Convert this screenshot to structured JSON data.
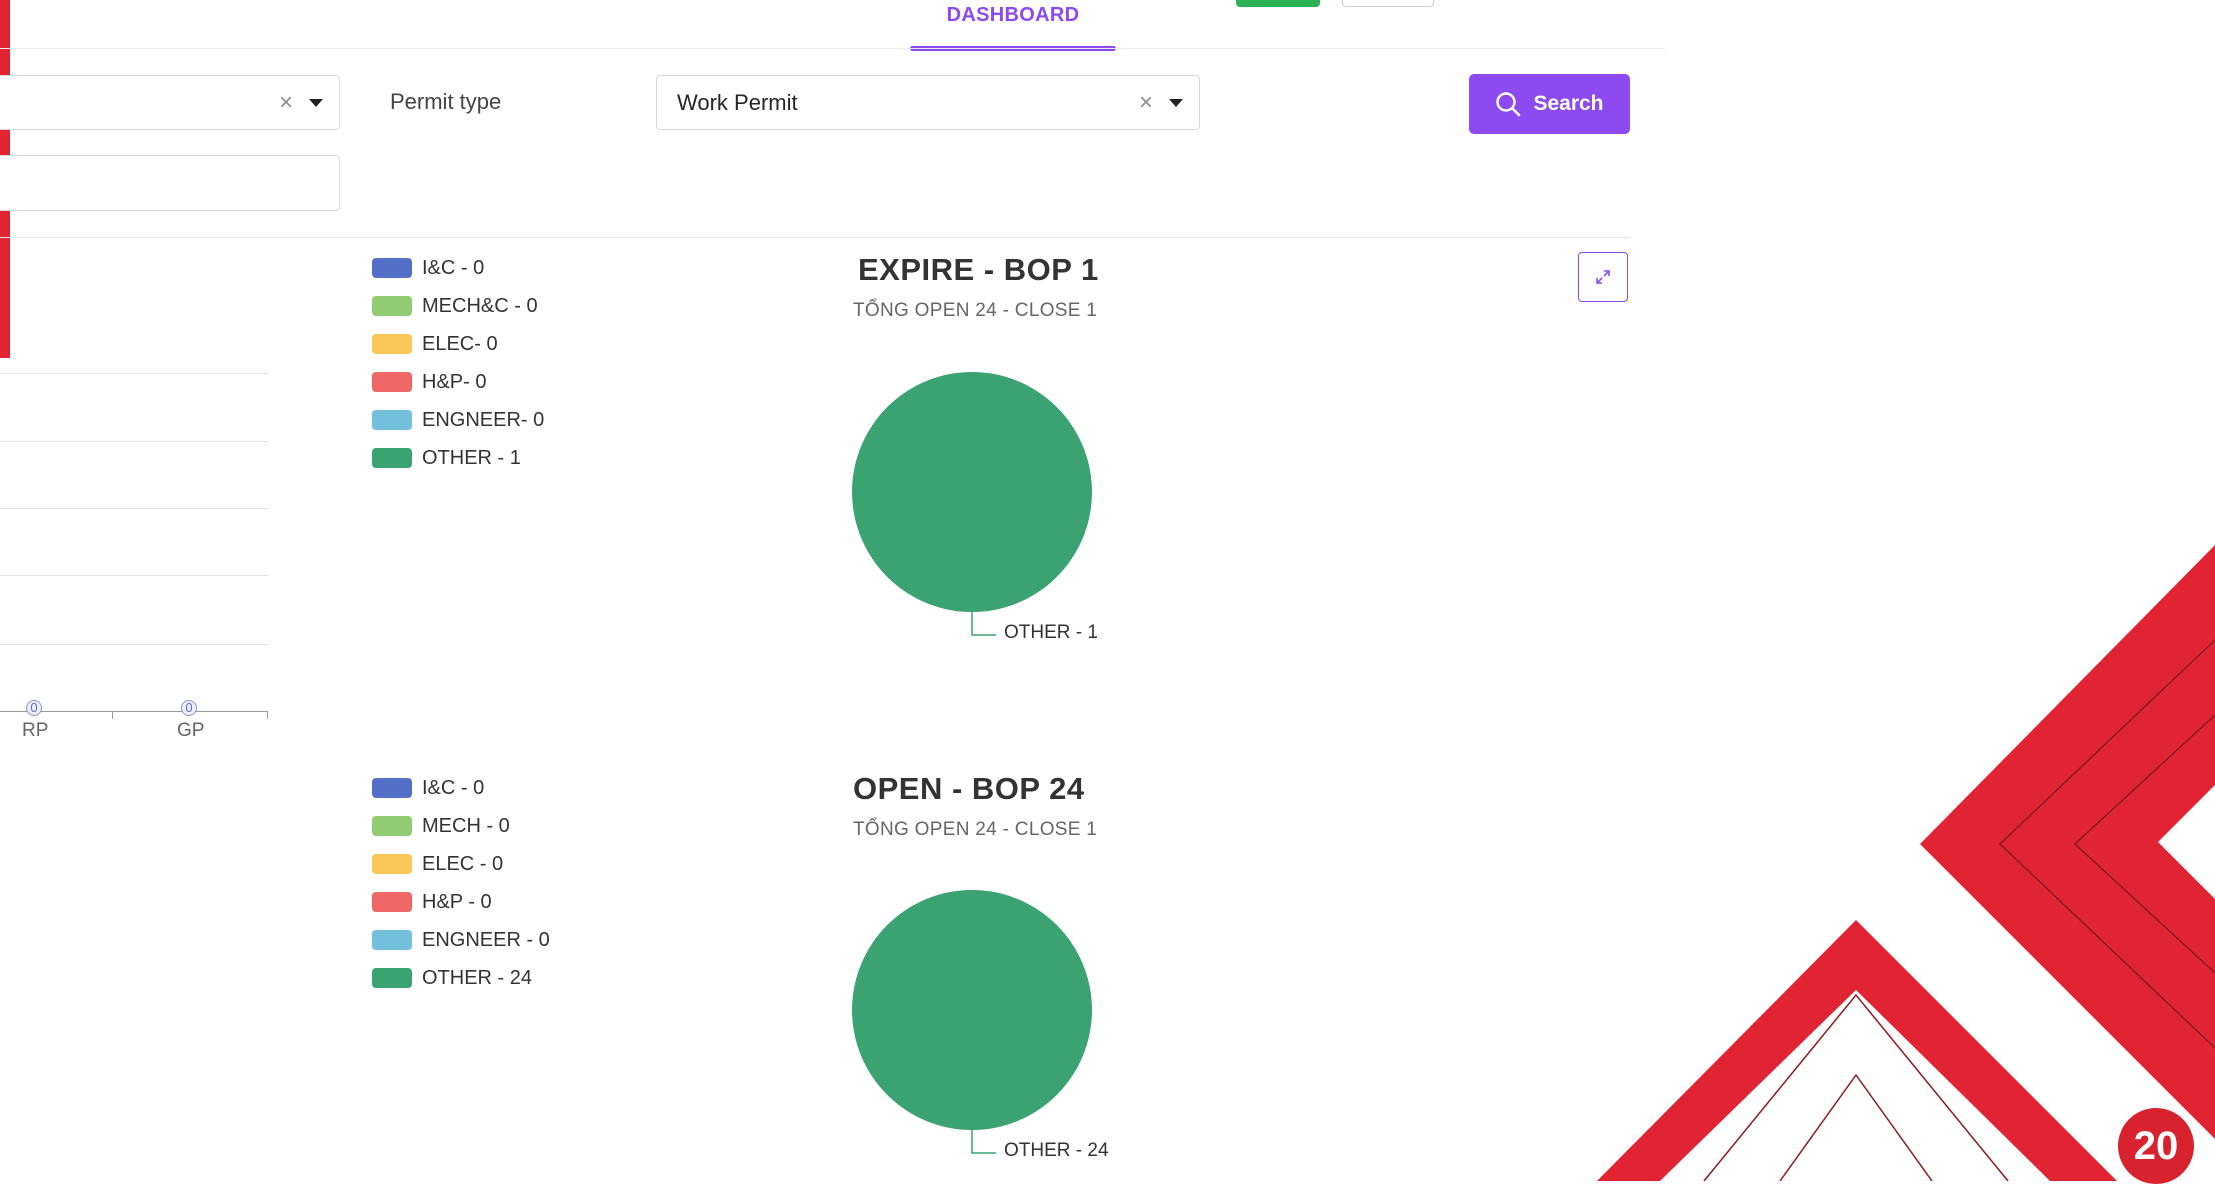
{
  "nav": {
    "dashboard_tab": "DASHBOARD"
  },
  "filters": {
    "permit_type_label": "Permit type",
    "permit_type_value": "Work Permit",
    "left_select_value": "",
    "left_input_value": "",
    "search_label": "Search"
  },
  "page_number": "20",
  "colors": {
    "accent": "#8c4af0",
    "brand_red": "#e02434",
    "ic": "#5470c6",
    "mech": "#91cc75",
    "elec": "#fac858",
    "hp": "#ee6666",
    "engineer": "#73c0de",
    "other": "#3ba272"
  },
  "left_chart": {
    "tick_labels": [
      "RP",
      "GP"
    ],
    "value_labels": [
      "0",
      "0"
    ]
  },
  "chart_data": [
    {
      "type": "pie",
      "title": "EXPIRE  - BOP 1",
      "subtitle": "TỔNG OPEN 24 - CLOSE 1",
      "legend": [
        "I&C - 0",
        "MECH&C - 0",
        "ELEC- 0",
        "H&P- 0",
        "ENGNEER- 0",
        "OTHER - 1"
      ],
      "values": [
        0,
        0,
        0,
        0,
        0,
        1
      ],
      "slice_label": "OTHER - 1",
      "legend_position": "left"
    },
    {
      "type": "pie",
      "title": "OPEN  - BOP 24",
      "subtitle": "TỔNG OPEN 24 - CLOSE 1",
      "legend": [
        "I&C - 0",
        "MECH - 0",
        "ELEC - 0",
        "H&P - 0",
        "ENGNEER - 0",
        "OTHER - 24"
      ],
      "values": [
        0,
        0,
        0,
        0,
        0,
        24
      ],
      "slice_label": "OTHER - 24",
      "legend_position": "left"
    }
  ]
}
